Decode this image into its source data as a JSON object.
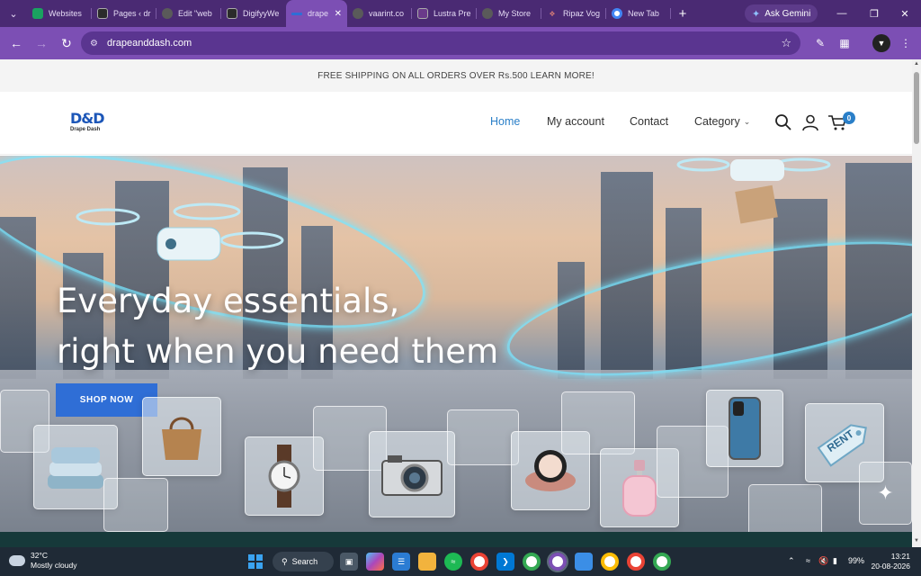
{
  "browser": {
    "tabs": [
      {
        "title": "Websites",
        "favicon_color": "#1aa260",
        "active": false
      },
      {
        "title": "Pages ‹ dr",
        "favicon_color": "#2b2b2b",
        "active": false
      },
      {
        "title": "Edit \"web",
        "favicon_color": "#5a5a5a",
        "active": false
      },
      {
        "title": "DigifyyWe",
        "favicon_color": "#2b2b2b",
        "active": false
      },
      {
        "title": "drape",
        "favicon_color": "#7c4fb4",
        "active": true
      },
      {
        "title": "vaarint.co",
        "favicon_color": "#5a5a5a",
        "active": false
      },
      {
        "title": "Lustra Pre",
        "favicon_color": "#6a3a8a",
        "active": false
      },
      {
        "title": "My Store",
        "favicon_color": "#5a5a5a",
        "active": false
      },
      {
        "title": "Ripaz Vog",
        "favicon_color": "#6a3a8a",
        "active": false
      },
      {
        "title": "New Tab",
        "favicon_color": "#4285f4",
        "active": false
      }
    ],
    "gemini_label": "Ask Gemini",
    "url": "drapeanddash.com",
    "accent": "#7c4fb4",
    "tabstrip_color": "#4a2a73"
  },
  "site": {
    "promo": "FREE SHIPPING ON ALL ORDERS OVER Rs.500 LEARN MORE!",
    "logo": {
      "mark": "D&D",
      "sub": "Drape Dash"
    },
    "nav": {
      "home": "Home",
      "account": "My account",
      "contact": "Contact",
      "category": "Category"
    },
    "cart_count": "0",
    "hero": {
      "line1": "Everyday essentials,",
      "line2": "right when you need them",
      "cta": "SHOP NOW",
      "rent_tag": "RENT"
    },
    "link_color": "#2a7fc8",
    "button_color": "#2f6ed6"
  },
  "taskbar": {
    "temperature": "32°C",
    "weather": "Mostly cloudy",
    "search": "Search",
    "battery": "99%",
    "time": "13:21",
    "date": "20-08-2026"
  }
}
